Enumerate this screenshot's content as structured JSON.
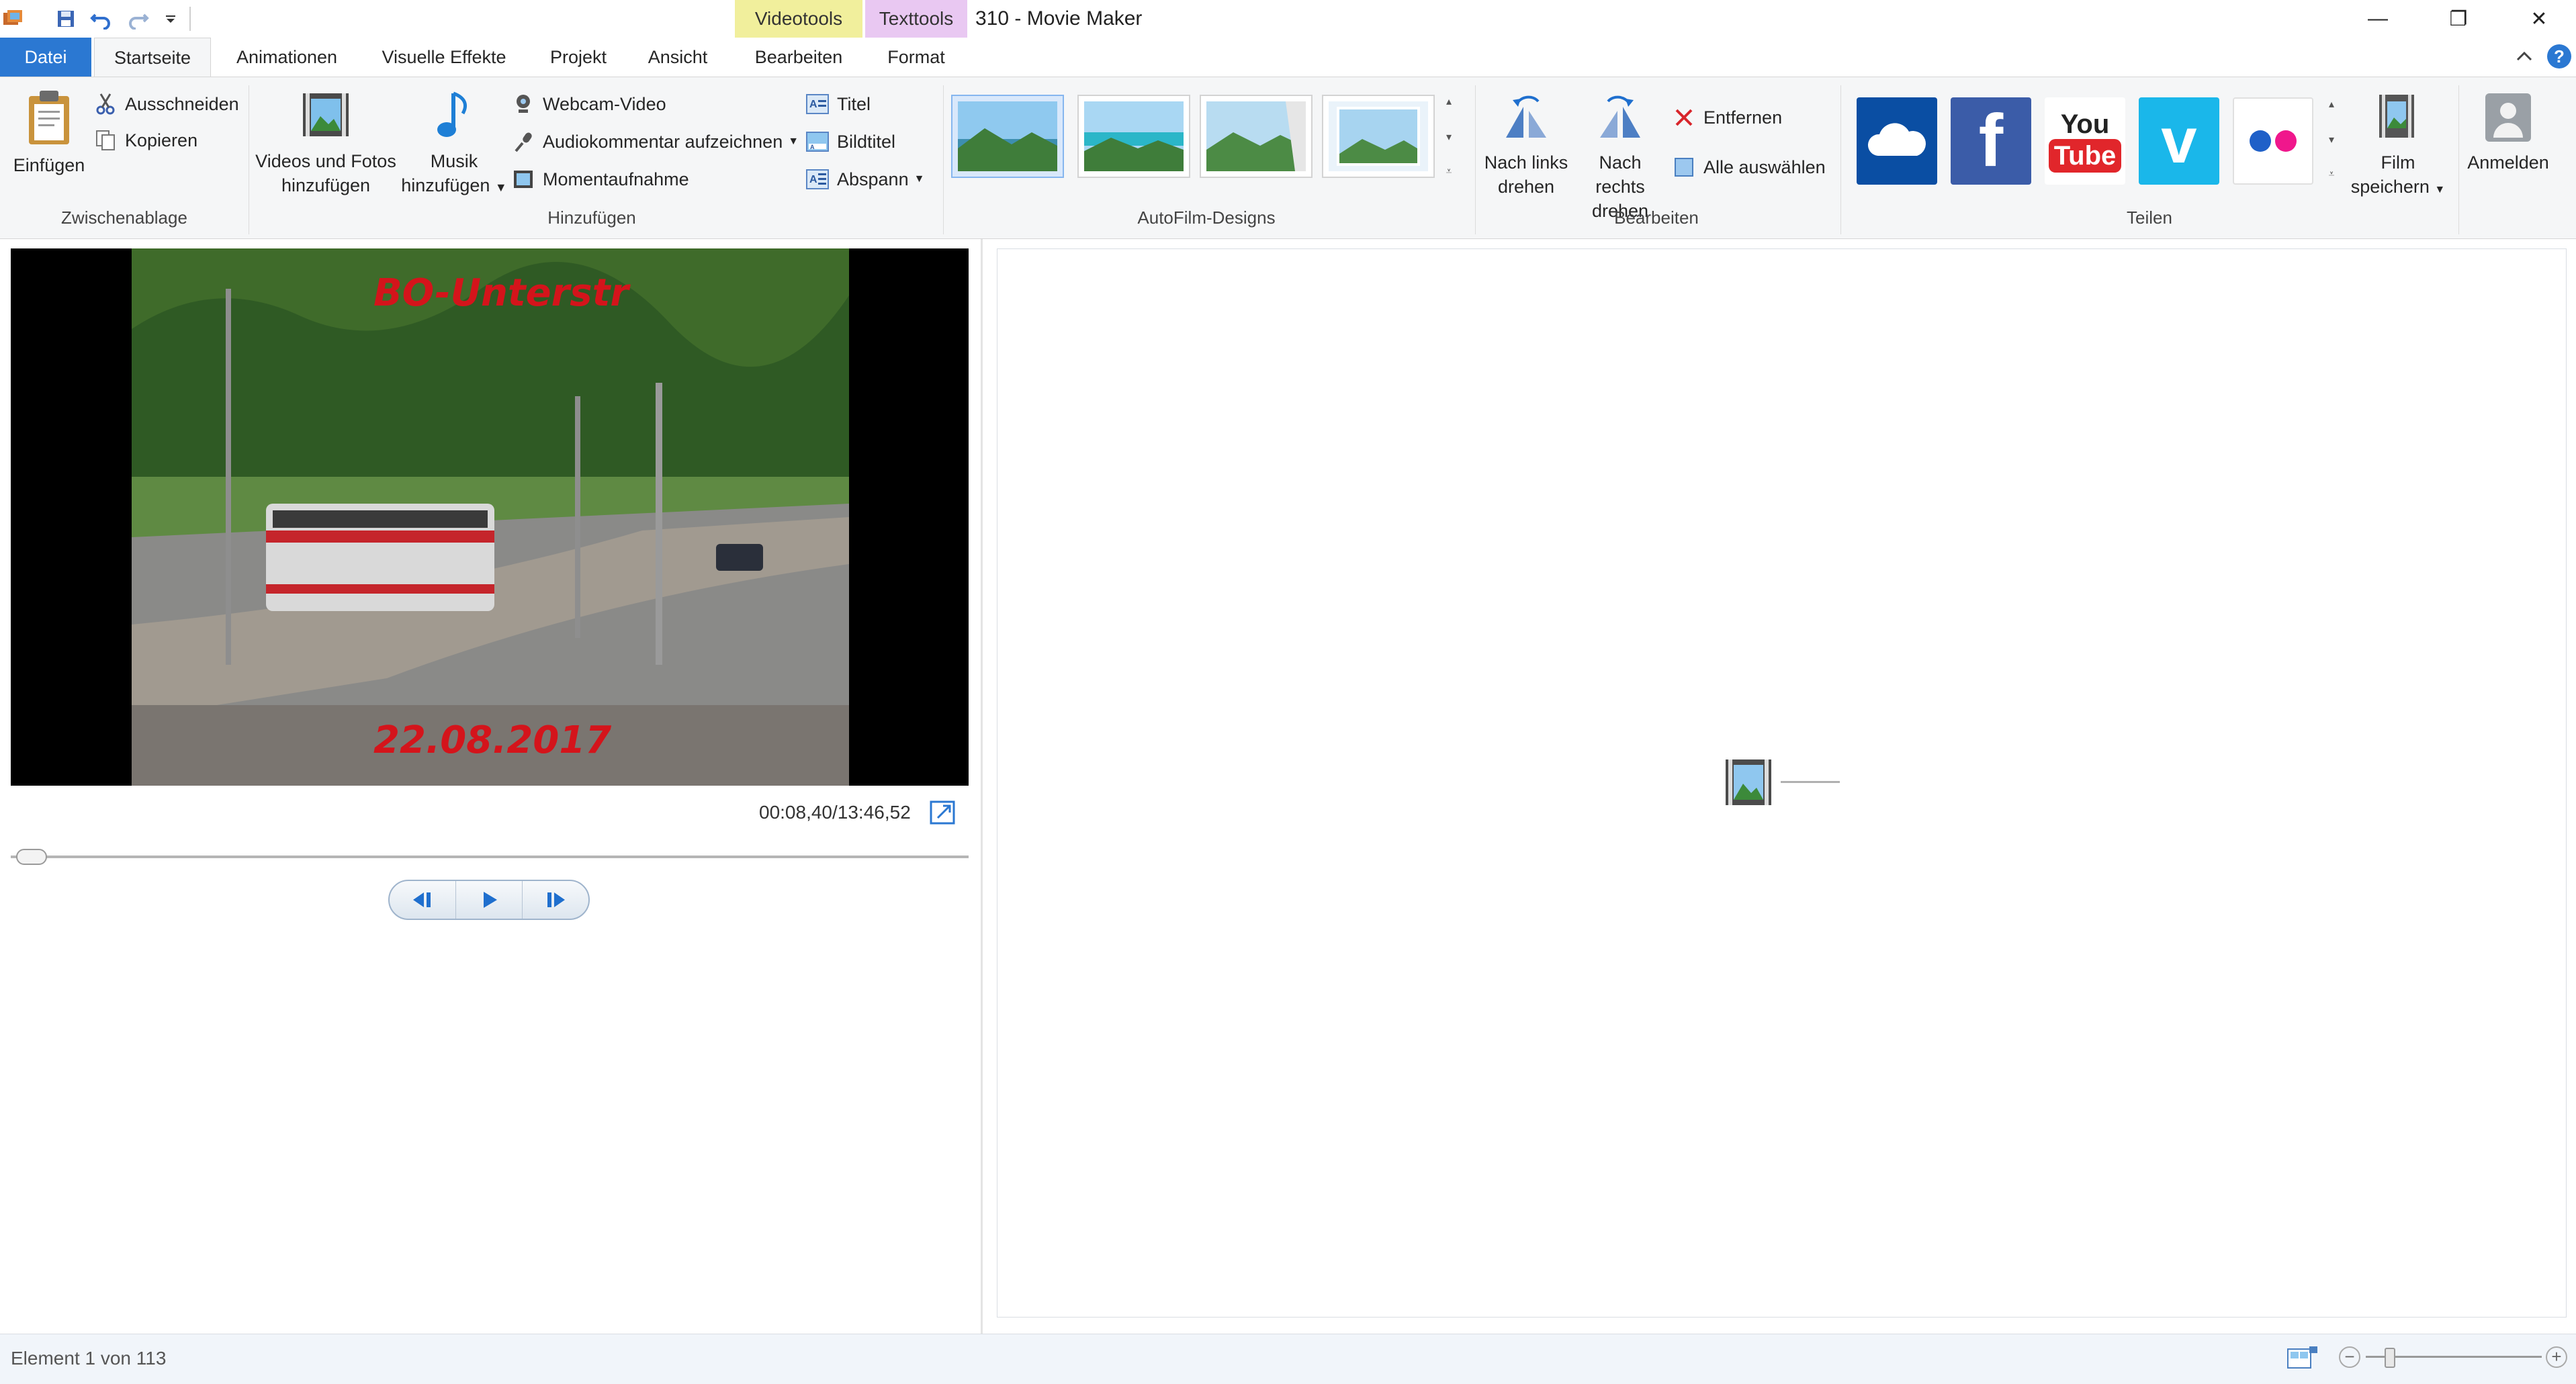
{
  "window": {
    "title": "310 - Movie Maker",
    "context_tabs": {
      "video": "Videotools",
      "text": "Texttools"
    },
    "buttons": {
      "minimize": "—",
      "restore": "❐",
      "close": "✕"
    }
  },
  "tabs": [
    "Datei",
    "Startseite",
    "Animationen",
    "Visuelle Effekte",
    "Projekt",
    "Ansicht",
    "Bearbeiten",
    "Format"
  ],
  "ribbon": {
    "clipboard": {
      "paste": "Einfügen",
      "cut": "Ausschneiden",
      "copy": "Kopieren",
      "label": "Zwischenablage"
    },
    "add": {
      "videos_photos": [
        "Videos und Fotos",
        "hinzufügen"
      ],
      "music": [
        "Musik",
        "hinzufügen"
      ],
      "webcam": "Webcam-Video",
      "narration": "Audiokommentar aufzeichnen",
      "snapshot": "Momentaufnahme",
      "title": "Titel",
      "caption": "Bildtitel",
      "credits": "Abspann",
      "label": "Hinzufügen"
    },
    "themes": {
      "label": "AutoFilm-Designs"
    },
    "edit": {
      "rotate_left": [
        "Nach links",
        "drehen"
      ],
      "rotate_right": [
        "Nach rechts",
        "drehen"
      ],
      "remove": "Entfernen",
      "select_all": "Alle auswählen",
      "label": "Bearbeiten"
    },
    "share": {
      "label": "Teilen",
      "services": [
        "onedrive",
        "facebook",
        "youtube",
        "vimeo",
        "flickr"
      ],
      "youtube_text": [
        "You",
        "Tube"
      ],
      "save_movie": [
        "Film",
        "speichern"
      ]
    },
    "signin": "Anmelden"
  },
  "preview": {
    "overlay_top": "BO-Unterstr",
    "overlay_bottom": "22.08.2017",
    "time": "00:08,40/13:46,52",
    "progress": 0.006
  },
  "status": {
    "element": "Element 1 von 113"
  },
  "colors": {
    "accent": "#2b78d2",
    "videotools": "#f1ef9c",
    "texttools": "#e9c8f2",
    "overlay_text": "#d4141b"
  }
}
